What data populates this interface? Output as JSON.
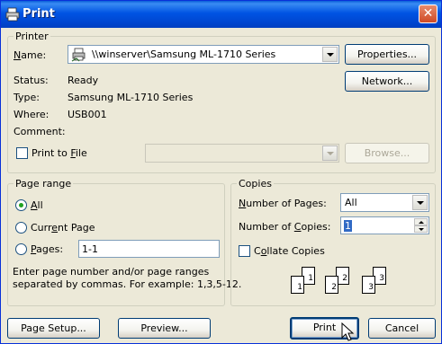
{
  "window": {
    "title": "Print",
    "close_label": "✕"
  },
  "printer_group": {
    "label": "Printer",
    "name_label": "Name:",
    "name_value": "\\\\winserver\\Samsung ML-1710 Series",
    "properties_button": "Properties...",
    "network_button": "Network...",
    "status_label": "Status:",
    "status_value": "Ready",
    "type_label": "Type:",
    "type_value": "Samsung ML-1710 Series",
    "where_label": "Where:",
    "where_value": "USB001",
    "comment_label": "Comment:",
    "comment_value": "",
    "print_to_file_label": "Print to File",
    "print_to_file_checked": false,
    "browse_button": "Browse..."
  },
  "page_range": {
    "label": "Page range",
    "options": [
      "All",
      "Current Page",
      "Pages:"
    ],
    "selected": "All",
    "pages_value": "1-1",
    "hint": [
      "Enter page number and/or page ranges",
      "separated by commas. For example: 1,3,5-12."
    ]
  },
  "copies": {
    "label": "Copies",
    "number_of_pages_label": "Number of Pages:",
    "number_of_pages_value": "All",
    "number_of_copies_label": "Number of Copies:",
    "number_of_copies_value": "1",
    "collate_label": "Collate Copies",
    "collate_checked": false,
    "collate_pages": [
      "1",
      "1",
      "2",
      "2",
      "3",
      "3"
    ]
  },
  "footer": {
    "page_setup_button": "Page Setup...",
    "preview_button": "Preview...",
    "print_button": "Print",
    "cancel_button": "Cancel"
  },
  "colors": {
    "titlebar": "#0054e3",
    "dialog_bg": "#ece9d8",
    "selection": "#316ac5"
  }
}
